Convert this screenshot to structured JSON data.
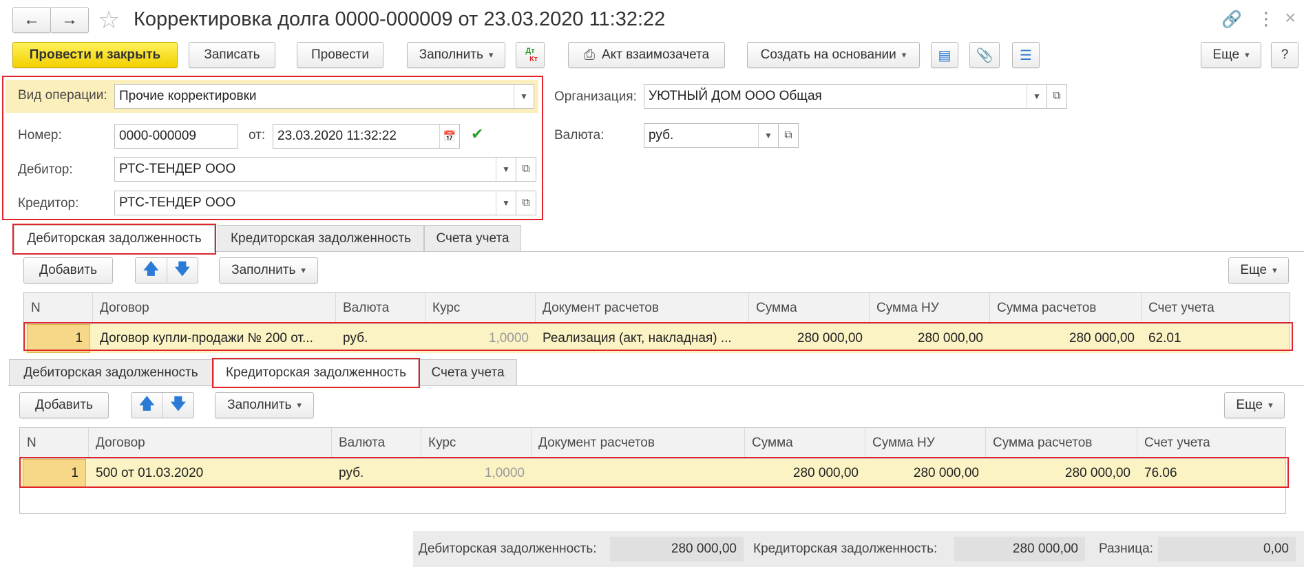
{
  "window": {
    "title": "Корректировка долга 0000-000009 от 23.03.2020 11:32:22"
  },
  "toolbar": {
    "post_close": "Провести и закрыть",
    "save": "Записать",
    "post": "Провести",
    "fill": "Заполнить",
    "dtkt_top": "Дт",
    "dtkt_bottom": "Кт",
    "offset_act": "Акт взаимозачета",
    "create_based": "Создать на основании",
    "more": "Еще",
    "help": "?"
  },
  "form": {
    "operation_label": "Вид операции:",
    "operation_value": "Прочие корректировки",
    "number_label": "Номер:",
    "number_value": "0000-000009",
    "date_label": "от:",
    "date_value": "23.03.2020 11:32:22",
    "debtor_label": "Дебитор:",
    "debtor_value": "РТС-ТЕНДЕР ООО",
    "creditor_label": "Кредитор:",
    "creditor_value": "РТС-ТЕНДЕР ООО",
    "org_label": "Организация:",
    "org_value": "УЮТНЫЙ ДОМ ООО  Общая",
    "currency_label": "Валюта:",
    "currency_value": "руб."
  },
  "tabs": [
    "Дебиторская задолженность",
    "Кредиторская задолженность",
    "Счета учета"
  ],
  "section_toolbar": {
    "add": "Добавить",
    "fill": "Заполнить",
    "more": "Еще"
  },
  "columns": [
    "N",
    "Договор",
    "Валюта",
    "Курс",
    "Документ расчетов",
    "Сумма",
    "Сумма НУ",
    "Сумма расчетов",
    "Счет учета"
  ],
  "debit_row": {
    "n": "1",
    "contract": "Договор купли-продажи № 200 от...",
    "currency": "руб.",
    "rate": "1,0000",
    "doc": "Реализация (акт, накладная) ...",
    "sum": "280 000,00",
    "sum_nu": "280 000,00",
    "sum_calc": "280 000,00",
    "account": "62.01"
  },
  "credit_row": {
    "n": "1",
    "contract": "500 от 01.03.2020",
    "currency": "руб.",
    "rate": "1,0000",
    "doc": "",
    "sum": "280 000,00",
    "sum_nu": "280 000,00",
    "sum_calc": "280 000,00",
    "account": "76.06"
  },
  "totals": {
    "debit_label": "Дебиторская задолженность:",
    "debit_value": "280 000,00",
    "credit_label": "Кредиторская задолженность:",
    "credit_value": "280 000,00",
    "diff_label": "Разница:",
    "diff_value": "0,00"
  },
  "colors": {
    "primary_button": "#f5d800",
    "highlight_row": "#fbf3c4",
    "annotation_red": "#e0242a",
    "arrow_blue": "#2a7ad6"
  }
}
